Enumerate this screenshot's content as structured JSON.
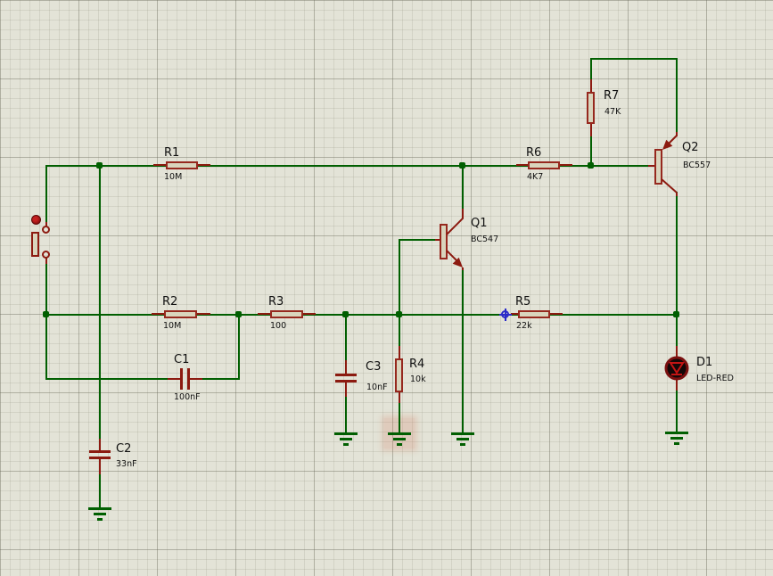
{
  "canvas": {
    "background": "#e3e3d7",
    "wire_color": "#015f01",
    "pin_color": "#8c1a10",
    "component_fill": "#d9d5bd",
    "component_stroke": "#96281e",
    "selection_highlight_color": "#d26e50",
    "origin_marker_color": "#2a2ac8"
  },
  "components": {
    "r1": {
      "ref": "R1",
      "value": "10M"
    },
    "r2": {
      "ref": "R2",
      "value": "10M"
    },
    "r3": {
      "ref": "R3",
      "value": "100"
    },
    "r4": {
      "ref": "R4",
      "value": "10k"
    },
    "r5": {
      "ref": "R5",
      "value": "22k"
    },
    "r6": {
      "ref": "R6",
      "value": "4K7"
    },
    "r7": {
      "ref": "R7",
      "value": "47K"
    },
    "c1": {
      "ref": "C1",
      "value": "100nF"
    },
    "c2": {
      "ref": "C2",
      "value": "33nF"
    },
    "c3": {
      "ref": "C3",
      "value": "10nF"
    },
    "q1": {
      "ref": "Q1",
      "value": "BC547"
    },
    "q2": {
      "ref": "Q2",
      "value": "BC557"
    },
    "d1": {
      "ref": "D1",
      "value": "LED-RED"
    }
  }
}
